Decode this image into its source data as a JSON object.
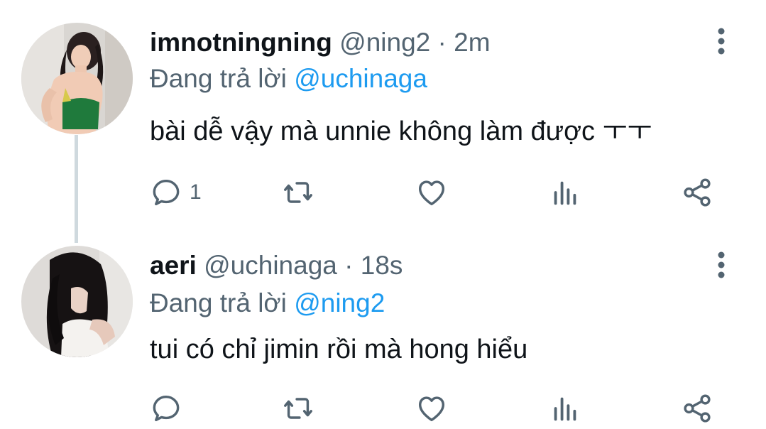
{
  "tweets": [
    {
      "display_name": "imnotningning",
      "handle": "@ning2",
      "separator": "·",
      "time": "2m",
      "reply_prefix": "Đang trả lời",
      "reply_to": "@uchinaga",
      "text": "bài dễ vậy mà unnie không làm được ㅜㅜ",
      "reply_count": "1",
      "avatar_icon": "user-photo-green-top"
    },
    {
      "display_name": "aeri",
      "handle": "@uchinaga",
      "separator": "·",
      "time": "18s",
      "reply_prefix": "Đang trả lời",
      "reply_to": "@ning2",
      "text": "tui có chỉ jimin rồi mà hong hiểu",
      "reply_count": "",
      "avatar_icon": "user-photo-long-hair"
    }
  ],
  "icons": {
    "reply": "reply-icon",
    "retweet": "retweet-icon",
    "like": "heart-icon",
    "views": "views-icon",
    "share": "share-icon",
    "more": "more-vertical-icon"
  },
  "colors": {
    "text": "#0f1419",
    "secondary": "#536471",
    "mention": "#1d9bf0",
    "thread_line": "#cfd9de"
  }
}
